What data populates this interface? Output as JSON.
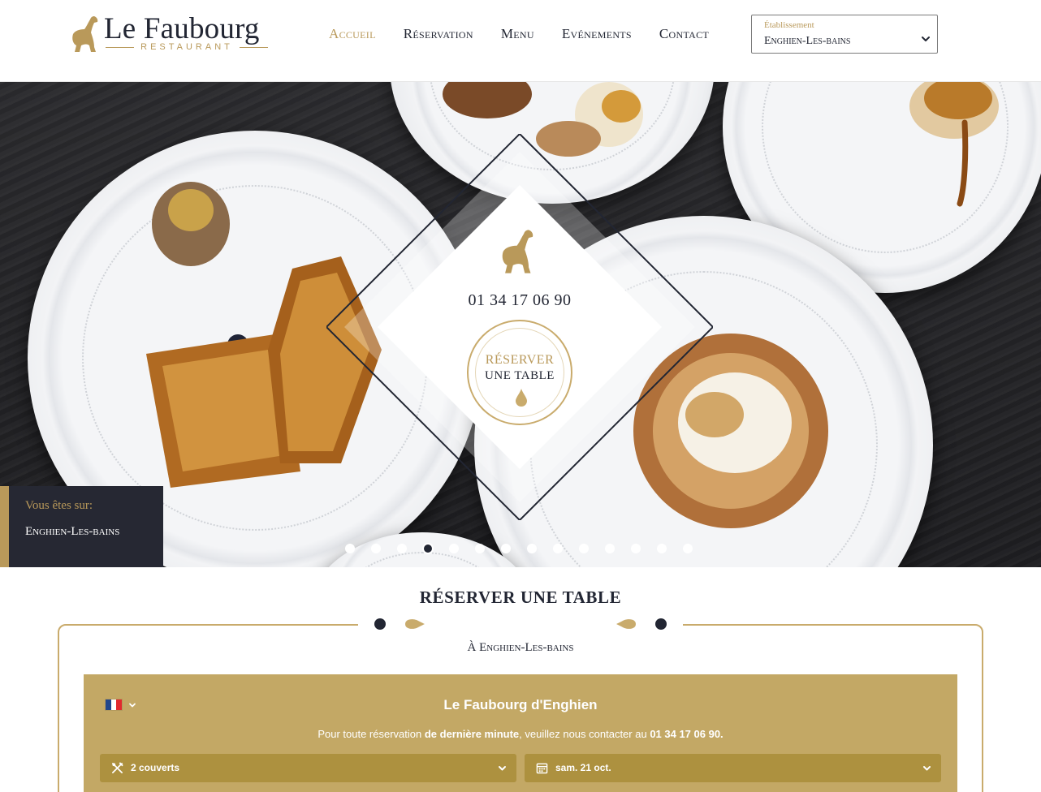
{
  "brand": {
    "name": "Le Faubourg",
    "subtitle": "RESTAURANT",
    "gold": "#b9995a",
    "dark": "#222633"
  },
  "nav": {
    "items": [
      {
        "label": "Accueil",
        "active": true
      },
      {
        "label": "Réservation",
        "active": false
      },
      {
        "label": "Menu",
        "active": false
      },
      {
        "label": "Evénements",
        "active": false
      },
      {
        "label": "Contact",
        "active": false
      }
    ]
  },
  "etablissement": {
    "label": "Établissement",
    "selected": "Enghien-Les-bains"
  },
  "hero": {
    "phone": "01 34 17 06 90",
    "reserve_line1": "RÉSERVER",
    "reserve_line2": "UNE TABLE",
    "location_label": "Vous êtes sur:",
    "location_value": "Enghien-Les-bains",
    "slides_count": 14,
    "active_slide": 4
  },
  "booking": {
    "title": "RÉSERVER UNE TABLE",
    "subtitle": "À Enghien-Les-bains",
    "widget": {
      "language_flag": "fr-flag",
      "title": "Le Faubourg d'Enghien",
      "note_prefix": "Pour toute réservation ",
      "note_bold": "de dernière minute",
      "note_mid": ", veuillez nous contacter au ",
      "note_phone": "01 34 17 06 90.",
      "covers": "2 couverts",
      "date": "sam. 21 oct."
    }
  }
}
